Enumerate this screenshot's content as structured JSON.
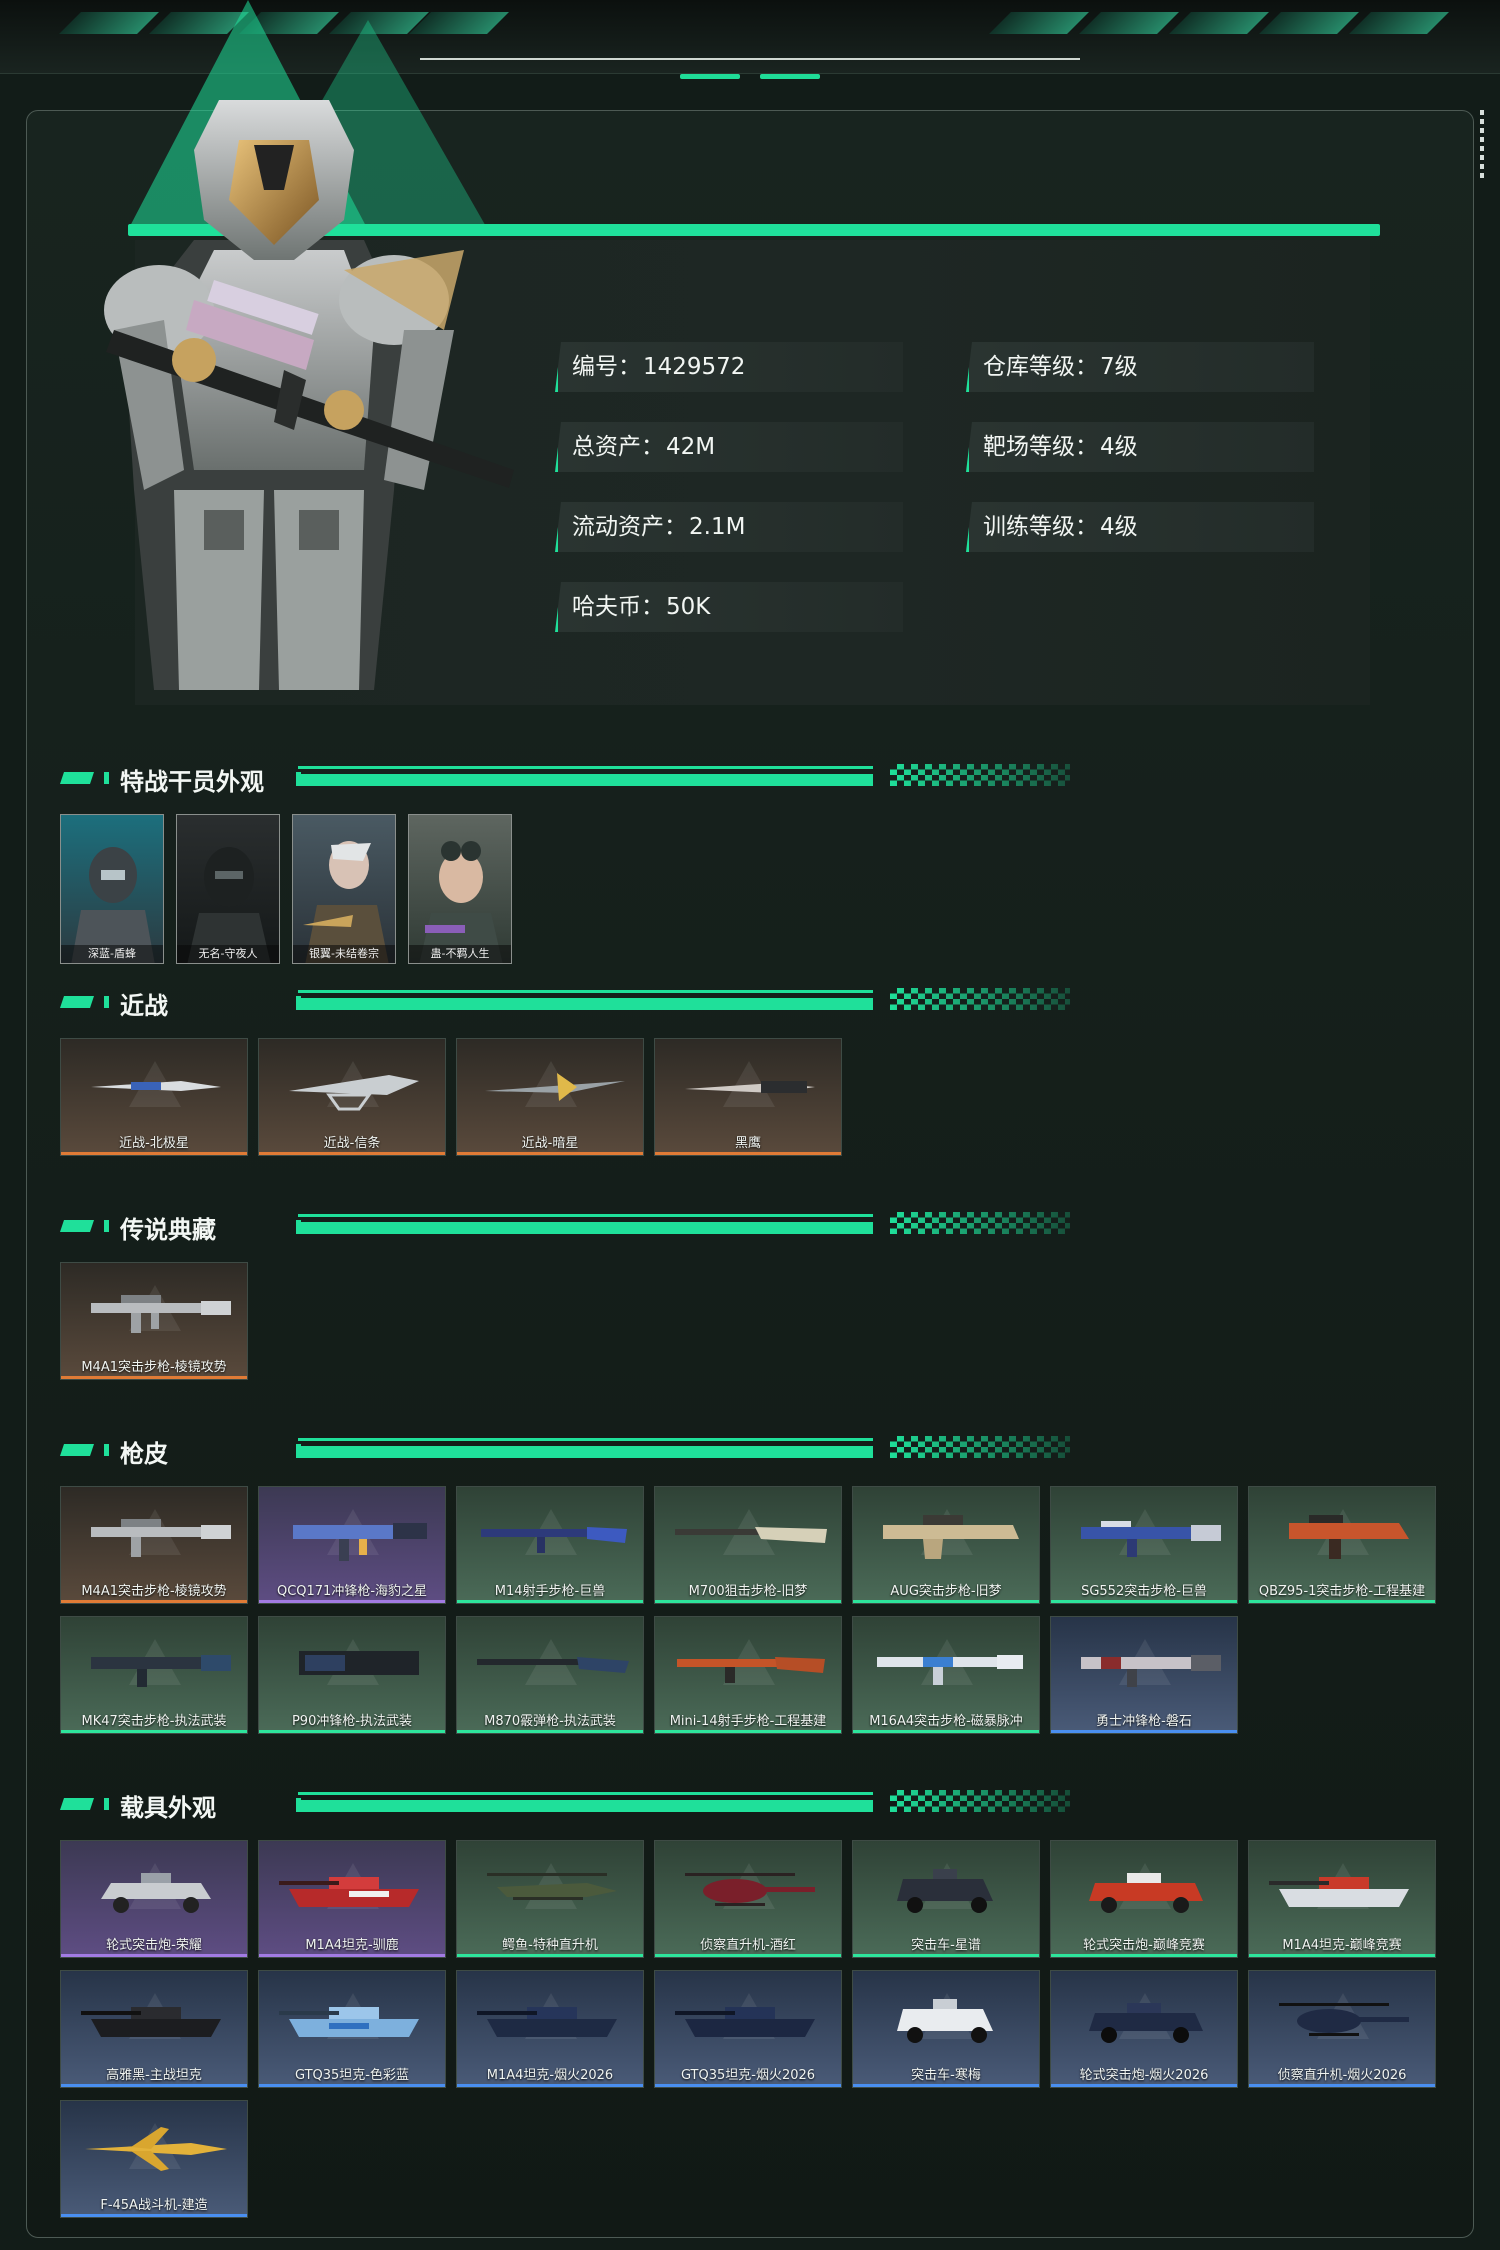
{
  "stats": {
    "id_label": "编号：",
    "id_value": "1429572",
    "total_assets_label": "总资产：",
    "total_assets_value": "42M",
    "liquid_assets_label": "流动资产：",
    "liquid_assets_value": "2.1M",
    "havoc_coin_label": "哈夫币：",
    "havoc_coin_value": "50K",
    "warehouse_level_label": "仓库等级：",
    "warehouse_level_value": "7级",
    "range_level_label": "靶场等级：",
    "range_level_value": "4级",
    "training_level_label": "训练等级：",
    "training_level_value": "4级"
  },
  "sections": {
    "operators": {
      "title": "特战干员外观",
      "items": [
        "深蓝-盾蜂",
        "无名-守夜人",
        "银翼-未结卷宗",
        "蛊-不羁人生"
      ]
    },
    "melee": {
      "title": "近战",
      "items": [
        "近战-北极星",
        "近战-信条",
        "近战-暗星",
        "黑鹰"
      ]
    },
    "legendary": {
      "title": "传说典藏",
      "items": [
        "M4A1突击步枪-棱镜攻势"
      ]
    },
    "gun_skins": {
      "title": "枪皮",
      "items": [
        "M4A1突击步枪-棱镜攻势",
        "QCQ171冲锋枪-海豹之星",
        "M14射手步枪-巨兽",
        "M700狙击步枪-旧梦",
        "AUG突击步枪-旧梦",
        "SG552突击步枪-巨兽",
        "QBZ95-1突击步枪-工程基建",
        "MK47突击步枪-执法武装",
        "P90冲锋枪-执法武装",
        "M870霰弹枪-执法武装",
        "Mini-14射手步枪-工程基建",
        "M16A4突击步枪-磁暴脉冲",
        "勇士冲锋枪-磐石"
      ]
    },
    "vehicles": {
      "title": "载具外观",
      "items": [
        "轮式突击炮-荣耀",
        "M1A4坦克-驯鹿",
        "鳄鱼-特种直升机",
        "侦察直升机-酒红",
        "突击车-星谱",
        "轮式突击炮-巅峰竞赛",
        "M1A4坦克-巅峰竞赛",
        "高雅黑-主战坦克",
        "GTQ35坦克-色彩蓝",
        "M1A4坦克-烟火2026",
        "GTQ35坦克-烟火2026",
        "突击车-寒梅",
        "轮式突击炮-烟火2026",
        "侦察直升机-烟火2026",
        "F-45A战斗机-建造"
      ]
    }
  },
  "colors": {
    "accent": "#1fe09a",
    "rarity_orange": "#e07b36",
    "rarity_purple": "#a27be3",
    "rarity_green": "#2ee59c",
    "rarity_blue": "#4a8ff0"
  }
}
